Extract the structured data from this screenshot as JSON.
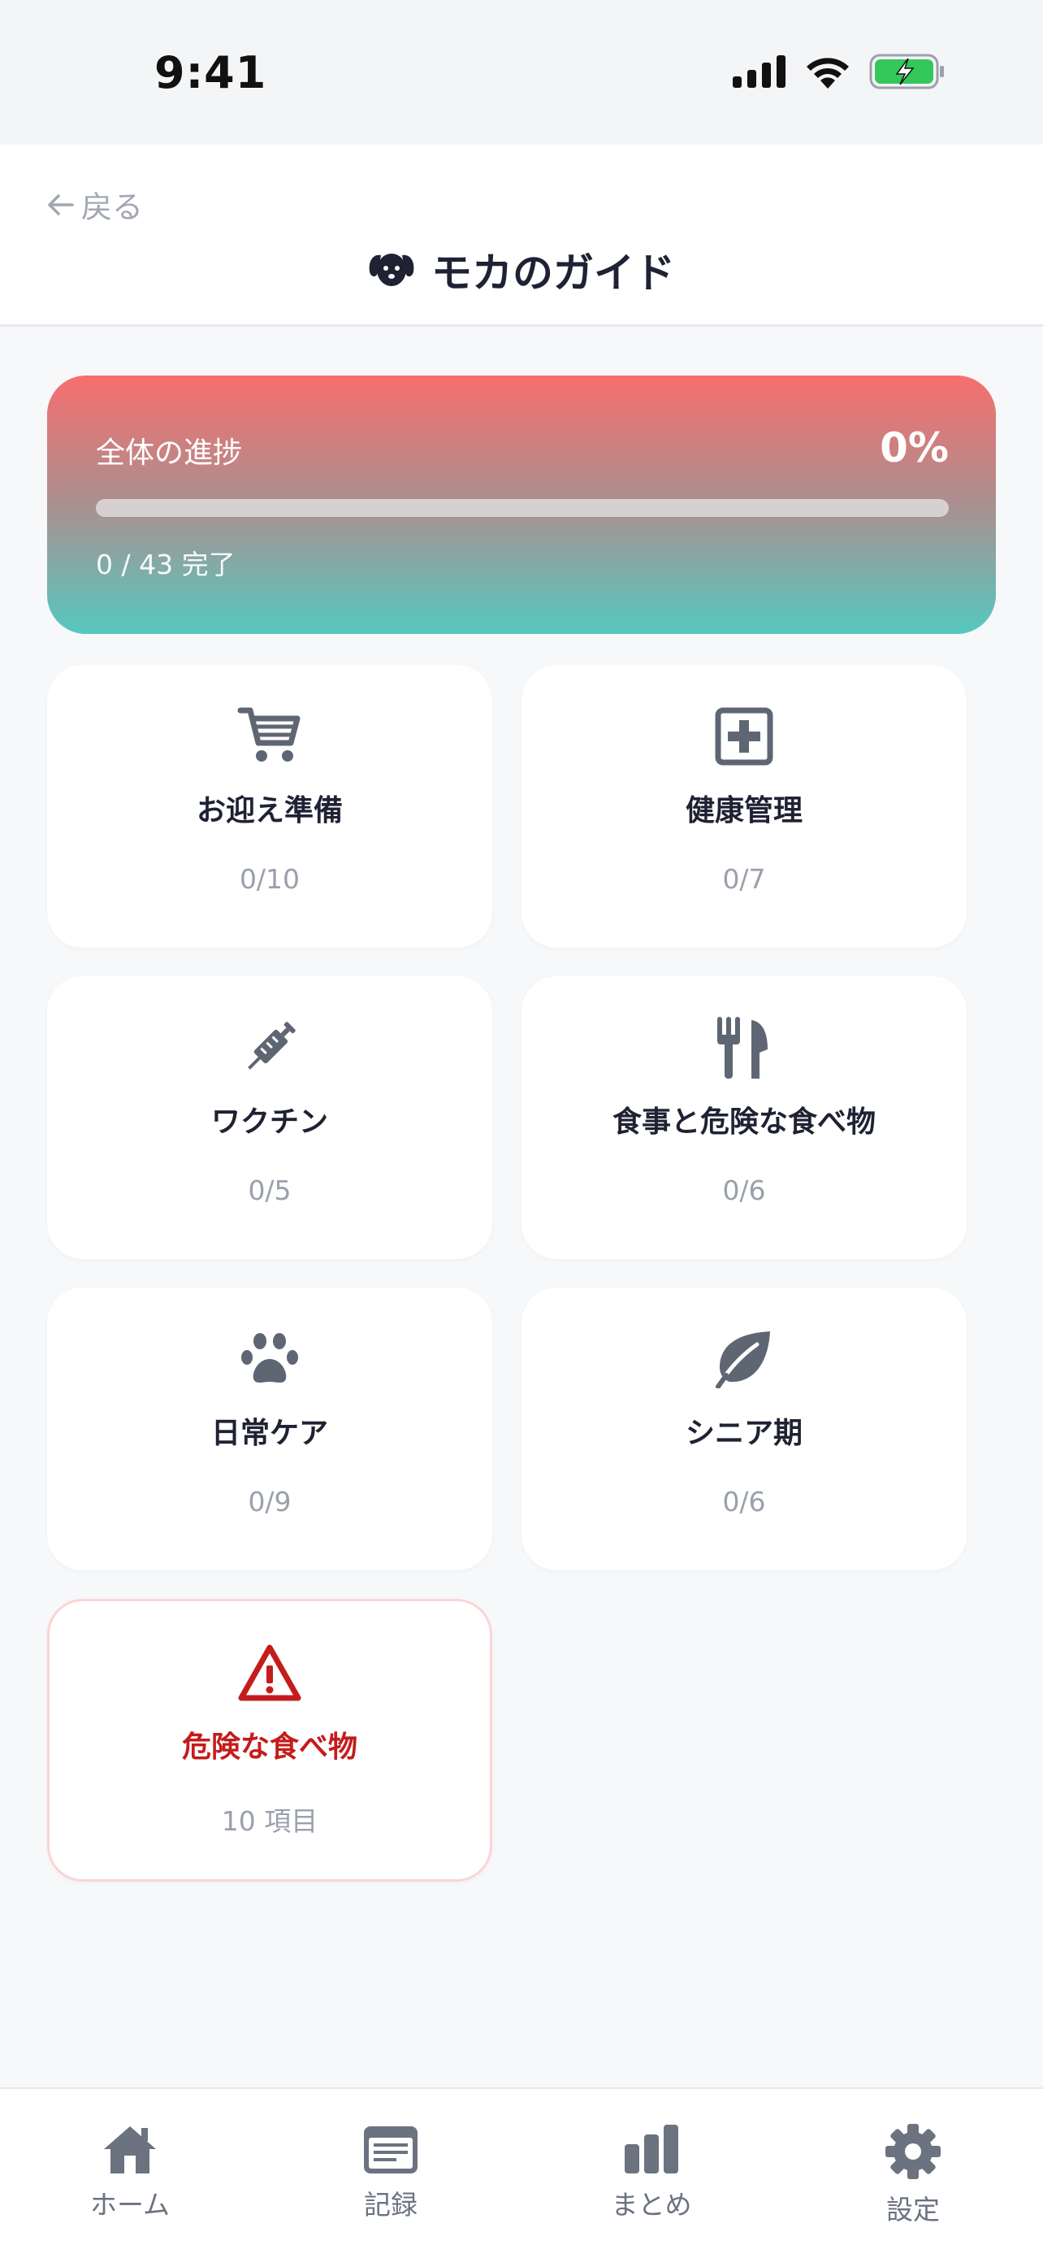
{
  "status": {
    "time": "9:41"
  },
  "header": {
    "back_label": "戻る",
    "title": "モカのガイド"
  },
  "progress": {
    "label": "全体の進捗",
    "percent_text": "0%",
    "fraction": 0,
    "count_text": "0 / 43 完了"
  },
  "cards": [
    {
      "icon": "cart-icon",
      "title": "お迎え準備",
      "sub": "0/10"
    },
    {
      "icon": "medical-plus-icon",
      "title": "健康管理",
      "sub": "0/7"
    },
    {
      "icon": "syringe-icon",
      "title": "ワクチン",
      "sub": "0/5"
    },
    {
      "icon": "fork-knife-icon",
      "title": "食事と危険な食べ物",
      "sub": "0/6"
    },
    {
      "icon": "paw-icon",
      "title": "日常ケア",
      "sub": "0/9"
    },
    {
      "icon": "leaf-icon",
      "title": "シニア期",
      "sub": "0/6"
    },
    {
      "icon": "warning-icon",
      "title": "危険な食べ物",
      "sub": "10 項目"
    }
  ],
  "tabs": [
    {
      "icon": "home-icon",
      "label": "ホーム"
    },
    {
      "icon": "record-icon",
      "label": "記録"
    },
    {
      "icon": "chart-icon",
      "label": "まとめ"
    },
    {
      "icon": "gear-icon",
      "label": "設定"
    }
  ],
  "colors": {
    "accent_red": "#f76e6e",
    "accent_teal": "#56c8c0",
    "danger": "#c41c1c",
    "icon_gray": "#5f6673"
  }
}
